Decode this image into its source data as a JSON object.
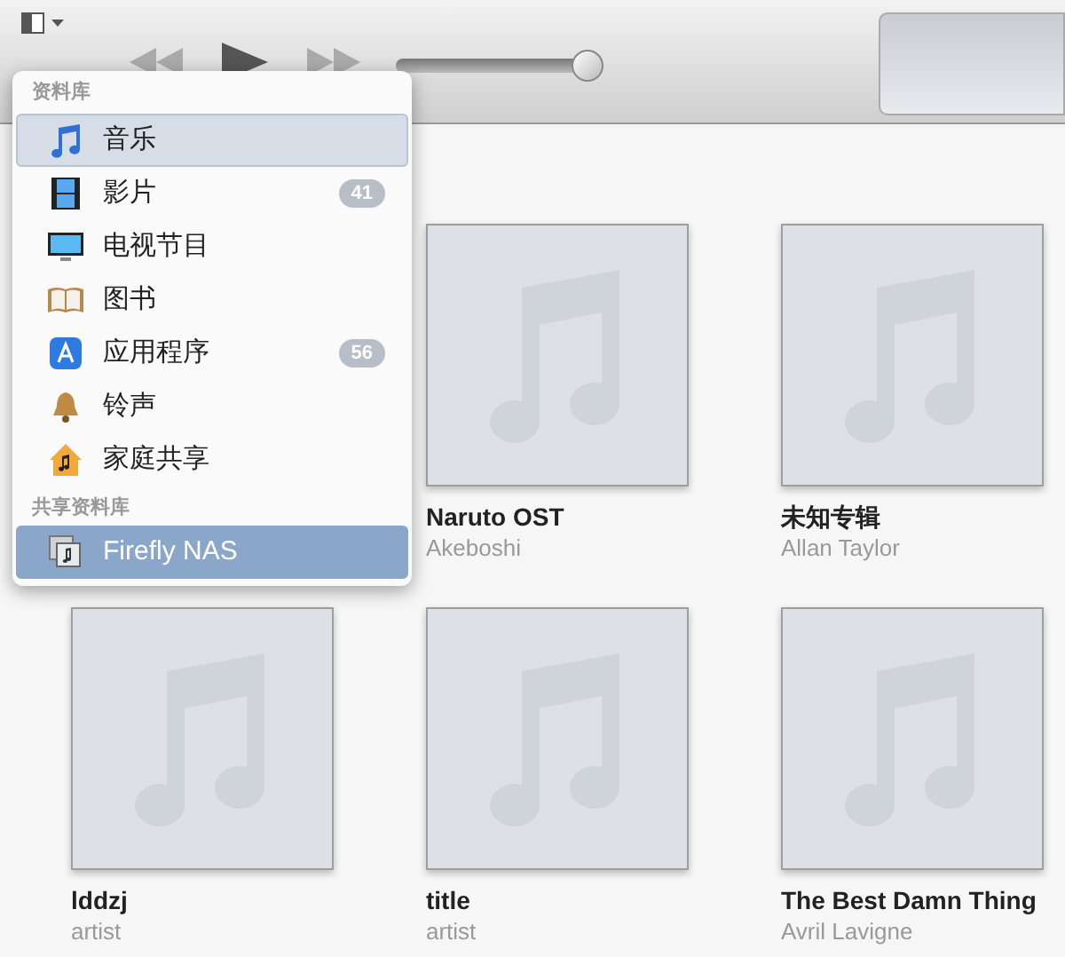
{
  "toolbar": {
    "volume": {
      "level": 0.93
    }
  },
  "library_menu": {
    "sections": [
      {
        "title": "资料库",
        "items": [
          {
            "kind": "music",
            "label": "音乐",
            "selected": false,
            "current": true
          },
          {
            "kind": "movies",
            "label": "影片",
            "count": "41",
            "selected": false,
            "current": false
          },
          {
            "kind": "tv",
            "label": "电视节目",
            "selected": false,
            "current": false
          },
          {
            "kind": "books",
            "label": "图书",
            "selected": false,
            "current": false
          },
          {
            "kind": "apps",
            "label": "应用程序",
            "count": "56",
            "selected": false,
            "current": false
          },
          {
            "kind": "tones",
            "label": "铃声",
            "selected": false,
            "current": false
          },
          {
            "kind": "home",
            "label": "家庭共享",
            "selected": false,
            "current": false
          }
        ]
      },
      {
        "title": "共享资料库",
        "items": [
          {
            "kind": "shared",
            "label": "Firefly NAS",
            "selected": true,
            "current": false
          }
        ]
      }
    ]
  },
  "albums": [
    {
      "kind": "hidden"
    },
    {
      "title": "Naruto OST",
      "artist": "Akeboshi"
    },
    {
      "title": "未知专辑",
      "artist": "Allan Taylor"
    },
    {
      "title": "lddzj",
      "artist": "artist"
    },
    {
      "title": "title",
      "artist": "artist"
    },
    {
      "title": "The Best Damn Thing",
      "artist": "Avril Lavigne"
    }
  ]
}
